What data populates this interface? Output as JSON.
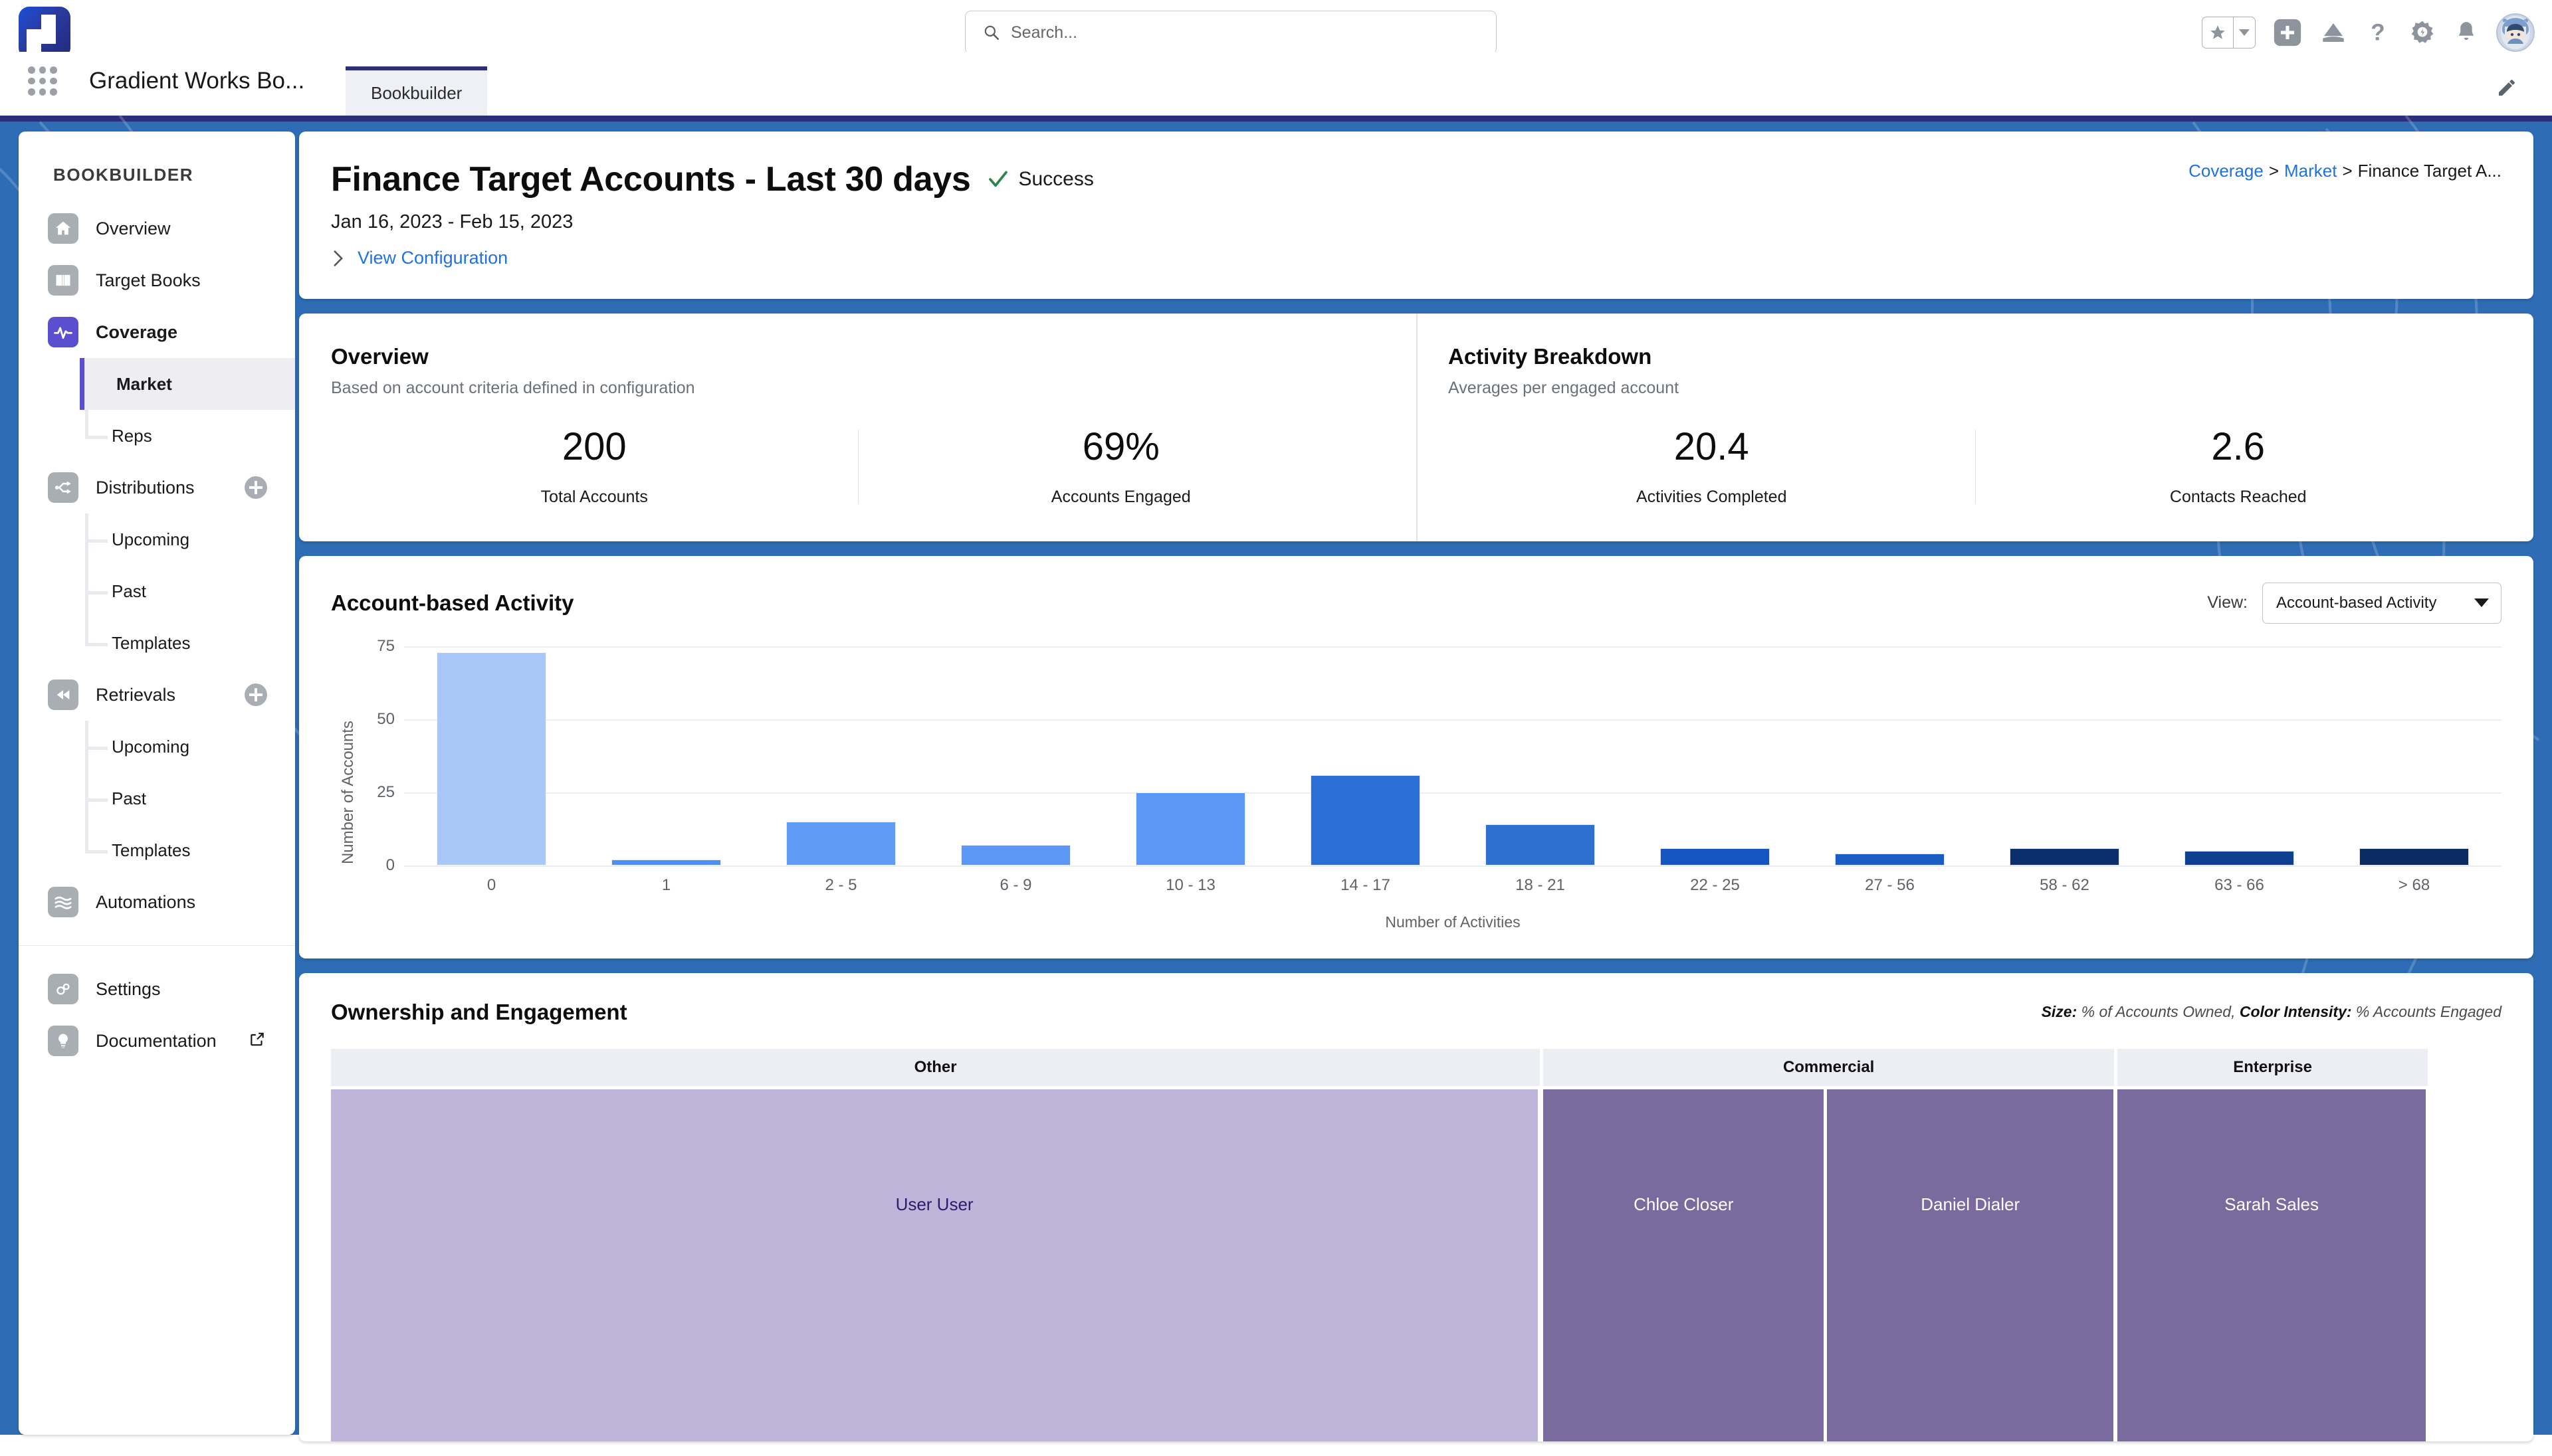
{
  "topbar": {
    "app_launcher_icon": "waffle-grid-icon",
    "logo_icon": "gradient-works-logo",
    "search": {
      "placeholder": "Search...",
      "value": "",
      "icon": "search-icon"
    },
    "icons": [
      {
        "name": "favorites-star-icon",
        "glyph": "star"
      },
      {
        "name": "favorites-dropdown-icon",
        "glyph": "caret-down"
      },
      {
        "name": "global-actions-plus-icon",
        "glyph": "plus"
      },
      {
        "name": "service-cloud-icon",
        "glyph": "cloud"
      },
      {
        "name": "help-icon",
        "glyph": "question"
      },
      {
        "name": "setup-gear-icon",
        "glyph": "gear"
      },
      {
        "name": "notifications-bell-icon",
        "glyph": "bell"
      },
      {
        "name": "user-avatar",
        "glyph": "avatar"
      }
    ]
  },
  "appnav": {
    "app_name": "Gradient Works Bo...",
    "tabs": [
      {
        "label": "Bookbuilder",
        "active": true
      }
    ],
    "edit_icon": "pencil-icon"
  },
  "sidebar": {
    "title": "BOOKBUILDER",
    "items": [
      {
        "label": "Overview",
        "icon": "home-icon",
        "type": "item",
        "active": false,
        "bold": false,
        "plus": false
      },
      {
        "label": "Target Books",
        "icon": "book-icon",
        "type": "item",
        "active": false,
        "bold": false,
        "plus": false
      },
      {
        "label": "Coverage",
        "icon": "pulse-icon",
        "type": "item",
        "active": true,
        "bold": true,
        "plus": false
      },
      {
        "label": "Market",
        "type": "sub",
        "selected": true,
        "last": false
      },
      {
        "label": "Reps",
        "type": "sub",
        "selected": false,
        "last": true
      },
      {
        "label": "Distributions",
        "icon": "distribute-icon",
        "type": "item",
        "active": false,
        "bold": false,
        "plus": true
      },
      {
        "label": "Upcoming",
        "type": "sub",
        "selected": false,
        "last": false
      },
      {
        "label": "Past",
        "type": "sub",
        "selected": false,
        "last": false
      },
      {
        "label": "Templates",
        "type": "sub",
        "selected": false,
        "last": true
      },
      {
        "label": "Retrievals",
        "icon": "rewind-icon",
        "type": "item",
        "active": false,
        "bold": false,
        "plus": true
      },
      {
        "label": "Upcoming",
        "type": "sub",
        "selected": false,
        "last": false
      },
      {
        "label": "Past",
        "type": "sub",
        "selected": false,
        "last": false
      },
      {
        "label": "Templates",
        "type": "sub",
        "selected": false,
        "last": true
      },
      {
        "label": "Automations",
        "icon": "waves-icon",
        "type": "item",
        "active": false,
        "bold": false,
        "plus": false
      },
      {
        "type": "divider"
      },
      {
        "label": "Settings",
        "icon": "gears-icon",
        "type": "item",
        "active": false,
        "bold": false,
        "plus": false
      },
      {
        "label": "Documentation",
        "icon": "lightbulb-icon",
        "type": "item",
        "active": false,
        "bold": false,
        "plus": false,
        "external": true
      }
    ]
  },
  "header": {
    "title": "Finance Target Accounts - Last 30 days",
    "status": "Success",
    "status_icon": "check-icon",
    "date_range": "Jan 16, 2023 - Feb 15, 2023",
    "config_link": "View Configuration",
    "config_icon": "chevron-right-icon",
    "breadcrumb": {
      "items": [
        "Coverage",
        "Market",
        "Finance Target A..."
      ],
      "separator": ">"
    }
  },
  "overview": {
    "title": "Overview",
    "subtitle": "Based on account criteria defined in configuration",
    "stats": [
      {
        "value": "200",
        "label": "Total Accounts"
      },
      {
        "value": "69%",
        "label": "Accounts Engaged"
      }
    ]
  },
  "activity_breakdown": {
    "title": "Activity Breakdown",
    "subtitle": "Averages per engaged account",
    "stats": [
      {
        "value": "20.4",
        "label": "Activities Completed"
      },
      {
        "value": "2.6",
        "label": "Contacts Reached"
      }
    ]
  },
  "activity_chart": {
    "title": "Account-based Activity",
    "view_label": "View:",
    "view_selected": "Account-based Activity",
    "view_options": [
      "Account-based Activity"
    ],
    "dropdown_icon": "caret-down-icon"
  },
  "chart_data": {
    "type": "bar",
    "title": "Account-based Activity",
    "xlabel": "Number of Activities",
    "ylabel": "Number of Accounts",
    "ylim": [
      0,
      75
    ],
    "yticks": [
      0,
      25,
      50,
      75
    ],
    "grid": true,
    "legend": "none",
    "categories": [
      "0",
      "1",
      "2 - 5",
      "6 - 9",
      "10 - 13",
      "14 - 17",
      "18 - 21",
      "22 - 25",
      "27 - 56",
      "58 - 62",
      "63 - 66",
      "> 68"
    ],
    "values": [
      73,
      2,
      15,
      7,
      25,
      31,
      14,
      6,
      4,
      6,
      5,
      6
    ],
    "colors": [
      "#aac7fa",
      "#4a90f0",
      "#609bf5",
      "#5b97f4",
      "#5b97f4",
      "#2a6fd6",
      "#2f6fd0",
      "#1455c2",
      "#1a5bc4",
      "#0b2f6e",
      "#0f3f8f",
      "#0a2a63"
    ]
  },
  "ownership": {
    "title": "Ownership and Engagement",
    "legend_size_label": "Size:",
    "legend_size_value": "% of Accounts Owned,",
    "legend_color_label": "Color Intensity:",
    "legend_color_value": "% Accounts Engaged",
    "groups": [
      {
        "header": "Other",
        "width": 55.7,
        "cells": [
          {
            "label": "User User",
            "width": 100,
            "color": "#bfb4d9",
            "text_color": "#2d1c6b"
          }
        ]
      },
      {
        "header": "Commercial",
        "width": 26.3,
        "cells": [
          {
            "label": "Chloe Closer",
            "width": 49.5,
            "color": "#7b6a9e",
            "text_color": "#ffffff"
          },
          {
            "label": "Daniel Dialer",
            "width": 50.5,
            "color": "#7b6a9e",
            "text_color": "#ffffff"
          }
        ]
      },
      {
        "header": "Enterprise",
        "width": 14.3,
        "cells": [
          {
            "label": "Sarah Sales",
            "width": 100,
            "color": "#7b6a9e",
            "text_color": "#ffffff"
          }
        ]
      }
    ]
  },
  "colors": {
    "brand_purple": "#5a4fcf",
    "page_blue": "#2e6db5",
    "link_blue": "#1f72e0",
    "success_green": "#2e844a",
    "nav_dark": "#2b2f7a"
  }
}
